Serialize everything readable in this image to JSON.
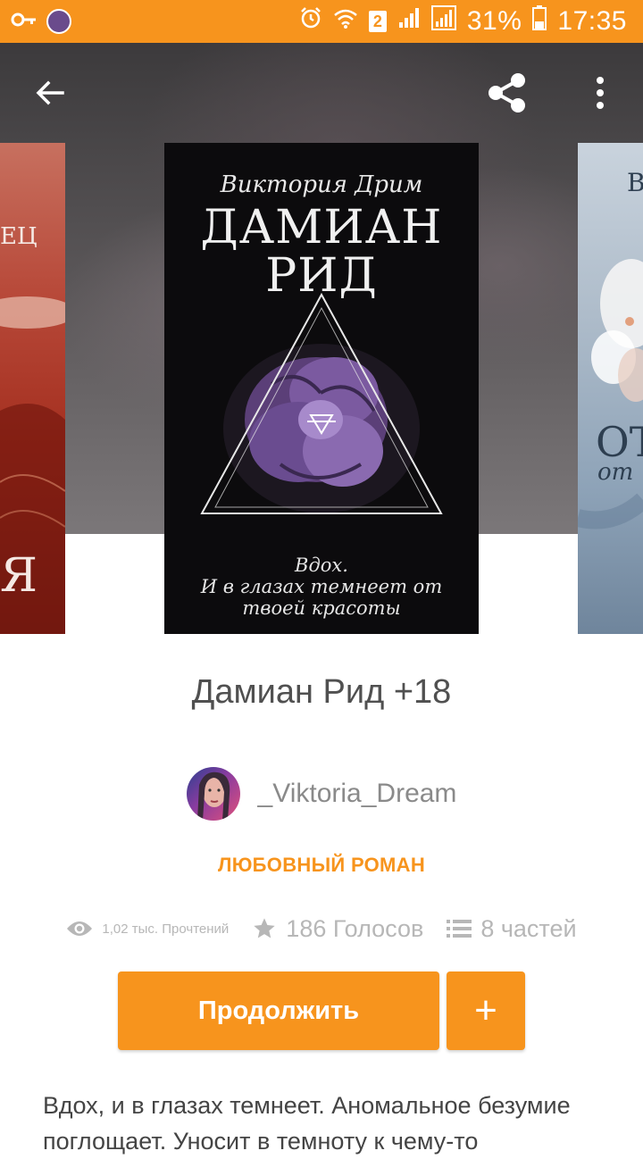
{
  "status_bar": {
    "battery_percent": "31%",
    "clock": "17:35",
    "sim_slot": "2",
    "icons": [
      "key-icon",
      "app-avatar-icon",
      "alarm-icon",
      "wifi-icon",
      "signal-icon",
      "signal-2-icon",
      "battery-icon"
    ]
  },
  "toolbar": {
    "icons": [
      "back-arrow-icon",
      "share-icon",
      "more-vertical-icon"
    ]
  },
  "cover": {
    "author": "Виктория Дрим",
    "title_line1": "ДАМИАН",
    "title_line2": "РИД",
    "tagline_line1": "Вдох.",
    "tagline_line2": "И в глазах темнеет от",
    "tagline_line3": "твоей красоты",
    "left_fragment_1": "ЕЦ",
    "left_fragment_2": "Я",
    "right_fragment_1": "В",
    "right_fragment_2": "ОТ",
    "right_fragment_3": "от"
  },
  "book": {
    "title": "Дамиан Рид +18",
    "author": "_Viktoria_Dream",
    "genre": "ЛЮБОВНЫЙ РОМАН"
  },
  "stats": {
    "reads": "1,02 тыс. Прочтений",
    "votes": "186 Голосов",
    "parts": "8 частей",
    "icons": [
      "eye-icon",
      "star-icon",
      "list-icon"
    ]
  },
  "actions": {
    "continue_label": "Продолжить",
    "add_label": "+"
  },
  "description": {
    "line1": "Вдох, и в глазах темнеет. Аномальное безумие",
    "line2": "поглощает. Уносит в темноту к чему-то"
  },
  "colors": {
    "accent": "#f7941d",
    "title_text": "#505050",
    "muted_text": "#b7b7b7"
  }
}
